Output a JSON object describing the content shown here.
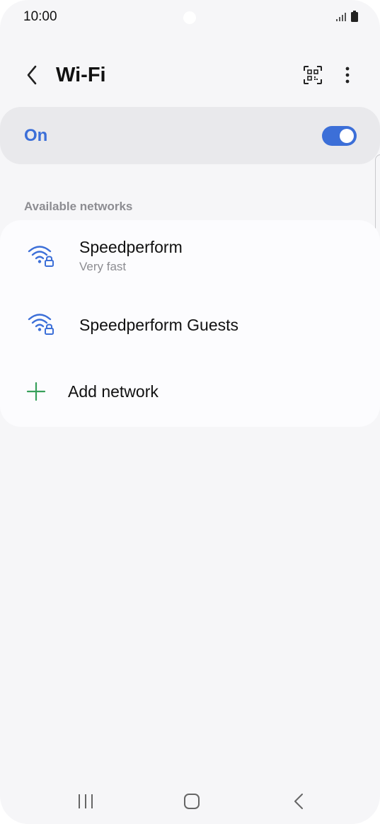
{
  "status_bar": {
    "time": "10:00"
  },
  "header": {
    "title": "Wi-Fi",
    "icons": {
      "back": "chevron-left-icon",
      "qr": "qr-code-scan-icon",
      "more": "more-vertical-icon"
    }
  },
  "wifi_toggle": {
    "label": "On",
    "state": "on"
  },
  "available_networks": {
    "section_label": "Available networks",
    "networks": [
      {
        "name": "Speedperform",
        "subtitle": "Very fast",
        "icon": "wifi-locked-icon"
      },
      {
        "name": "Speedperform Guests",
        "subtitle": "",
        "icon": "wifi-locked-icon"
      }
    ],
    "add_network": {
      "label": "Add network",
      "icon": "plus-icon"
    }
  },
  "nav_bar": {
    "icons": [
      "recent-apps-icon",
      "home-icon",
      "back-icon"
    ]
  },
  "colors": {
    "accent": "#3c6fd8",
    "wifi_icon": "#3c6fd8",
    "add_icon": "#37a05a",
    "background": "#f6f6f8",
    "card": "#fcfcfe",
    "toggle_card": "#e9e9ec",
    "secondary_text": "#8d8d92"
  }
}
